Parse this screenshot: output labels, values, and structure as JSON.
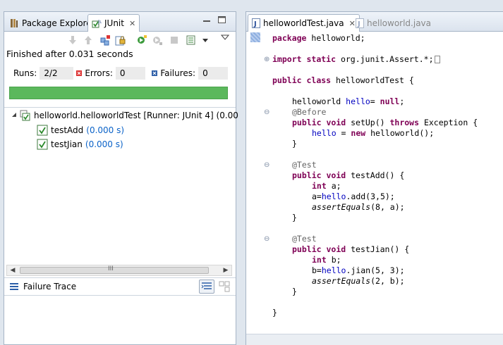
{
  "left": {
    "tabs": [
      {
        "label": "Package Explorer",
        "icon": "package-explorer-icon"
      },
      {
        "label": "JUnit",
        "icon": "junit-icon",
        "active": true
      }
    ],
    "status": "Finished after 0.031 seconds",
    "counters": {
      "runs_label": "Runs:",
      "runs_value": "2/2",
      "errors_label": "Errors:",
      "errors_value": "0",
      "failures_label": "Failures:",
      "failures_value": "0"
    },
    "progress": 1.0,
    "progress_color": "#5bb85c",
    "tree": {
      "root": "helloworld.helloworldTest [Runner: JUnit 4] (0.00",
      "children": [
        {
          "name": "testAdd",
          "time": "(0.000 s)"
        },
        {
          "name": "testJian",
          "time": "(0.000 s)"
        }
      ]
    },
    "scroll_mark": "III",
    "failure_trace_label": "Failure Trace"
  },
  "right": {
    "tabs": [
      {
        "label": "helloworldTest.java",
        "active": true
      },
      {
        "label": "helloworld.java",
        "active": false
      }
    ],
    "code": {
      "pkg_kw": "package",
      "pkg_rest": " helloworld;",
      "imp_kw1": "import",
      "imp_kw2": " static",
      "imp_rest": " org.junit.Assert.*;",
      "cls_kw1": "public",
      "cls_kw2": " class",
      "cls_rest": " helloworldTest {",
      "f1_type": "helloworld ",
      "f1_name": "hello",
      "f1_eq": "= ",
      "f1_null": "null",
      "f1_end": ";",
      "ann_before": "@Before",
      "m1_kw1": "public",
      "m1_kw2": " void",
      "m1_name": " setUp() ",
      "m1_kw3": "throws",
      "m1_rest": " Exception {",
      "m1_b_field": "hello",
      "m1_b_mid": " = ",
      "m1_b_kw": "new",
      "m1_b_rest": " helloworld();",
      "close": "}",
      "ann_test1": "@Test",
      "m2_kw1": "public",
      "m2_kw2": " void",
      "m2_rest": " testAdd() {",
      "m2_l1_kw": "int",
      "m2_l1_rest": " a;",
      "m2_l2_a": "a=",
      "m2_l2_field": "hello",
      "m2_l2_rest": ".add(3,5);",
      "m2_l3_it": "assertEquals",
      "m2_l3_rest": "(8, a);",
      "ann_test2": "@Test",
      "m3_kw1": "public",
      "m3_kw2": " void",
      "m3_rest": " testJian() {",
      "m3_l1_kw": "int",
      "m3_l1_rest": " b;",
      "m3_l2_a": "b=",
      "m3_l2_field": "hello",
      "m3_l2_rest": ".jian(5, 3);",
      "m3_l3_it": "assertEquals",
      "m3_l3_rest": "(2, b);",
      "class_close": "}"
    }
  },
  "colors": {
    "keyword": "#7f0055",
    "field": "#0000c0",
    "annotation": "#646464",
    "duration": "#0a62c8"
  }
}
